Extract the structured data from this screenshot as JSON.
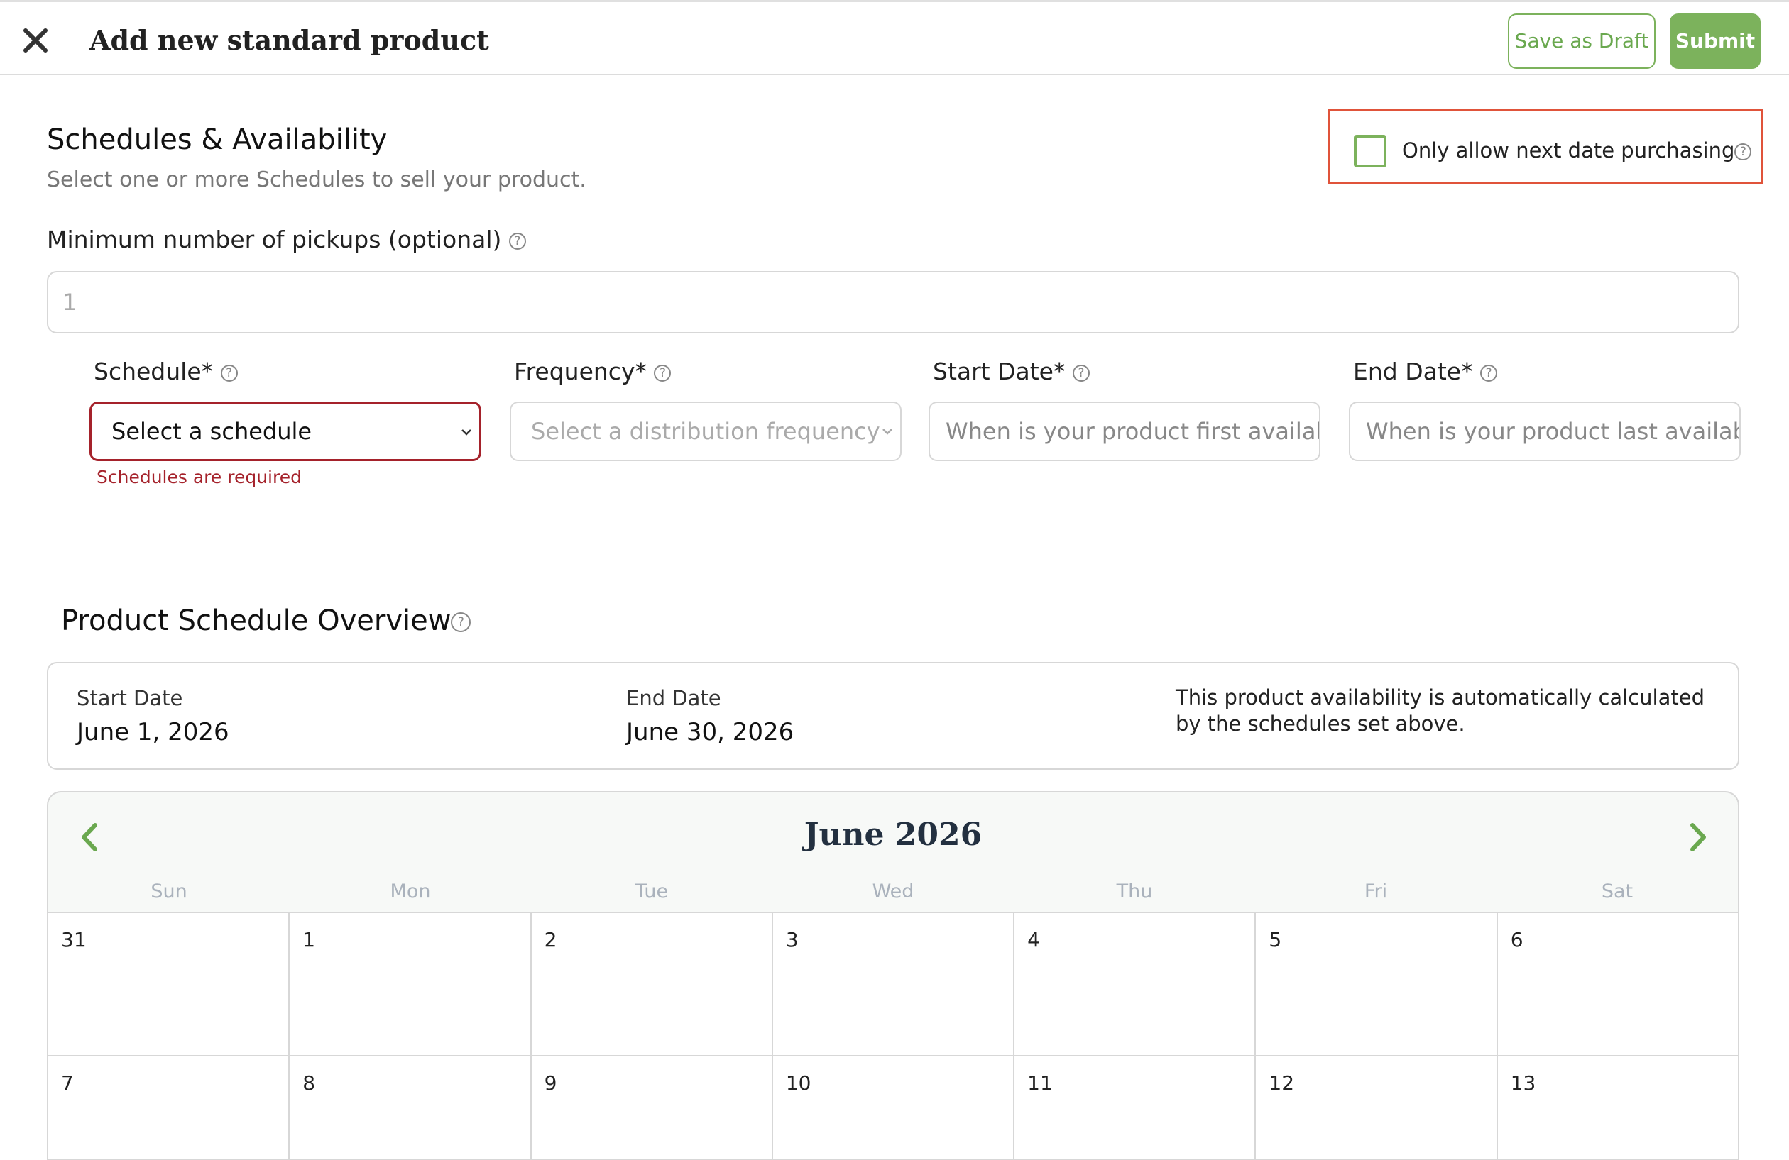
{
  "header": {
    "title": "Add new standard product",
    "save_draft_label": "Save as Draft",
    "submit_label": "Submit",
    "close_icon": "close-icon"
  },
  "schedules": {
    "title": "Schedules & Availability",
    "subtitle": "Select one or more Schedules to sell your product.",
    "next_date_label": "Only allow next date purchasing",
    "next_date_checked": false,
    "min_pickups_label": "Minimum number of pickups (optional)",
    "min_pickups_value": "1",
    "schedule_label": "Schedule*",
    "schedule_value": "Select a schedule",
    "schedule_error": "Schedules are required",
    "frequency_label": "Frequency*",
    "frequency_placeholder": "Select a distribution frequency",
    "start_label": "Start Date*",
    "start_placeholder": "When is your product first available?",
    "end_label": "End Date*",
    "end_placeholder": "When is your product last available?"
  },
  "overview": {
    "title": "Product Schedule Overview",
    "start_label": "Start Date",
    "start_value": "June 1, 2026",
    "end_label": "End Date",
    "end_value": "June 30, 2026",
    "note": "This product availability is automatically calculated by the schedules set above."
  },
  "calendar": {
    "month": "June 2026",
    "days_of_week": [
      "Sun",
      "Mon",
      "Tue",
      "Wed",
      "Thu",
      "Fri",
      "Sat"
    ],
    "weeks": [
      [
        "31",
        "1",
        "2",
        "3",
        "4",
        "5",
        "6"
      ],
      [
        "7",
        "8",
        "9",
        "10",
        "11",
        "12",
        "13"
      ]
    ]
  },
  "colors": {
    "accent": "#7cb25c",
    "error": "#a5222b",
    "highlight_box": "#e0533a"
  }
}
